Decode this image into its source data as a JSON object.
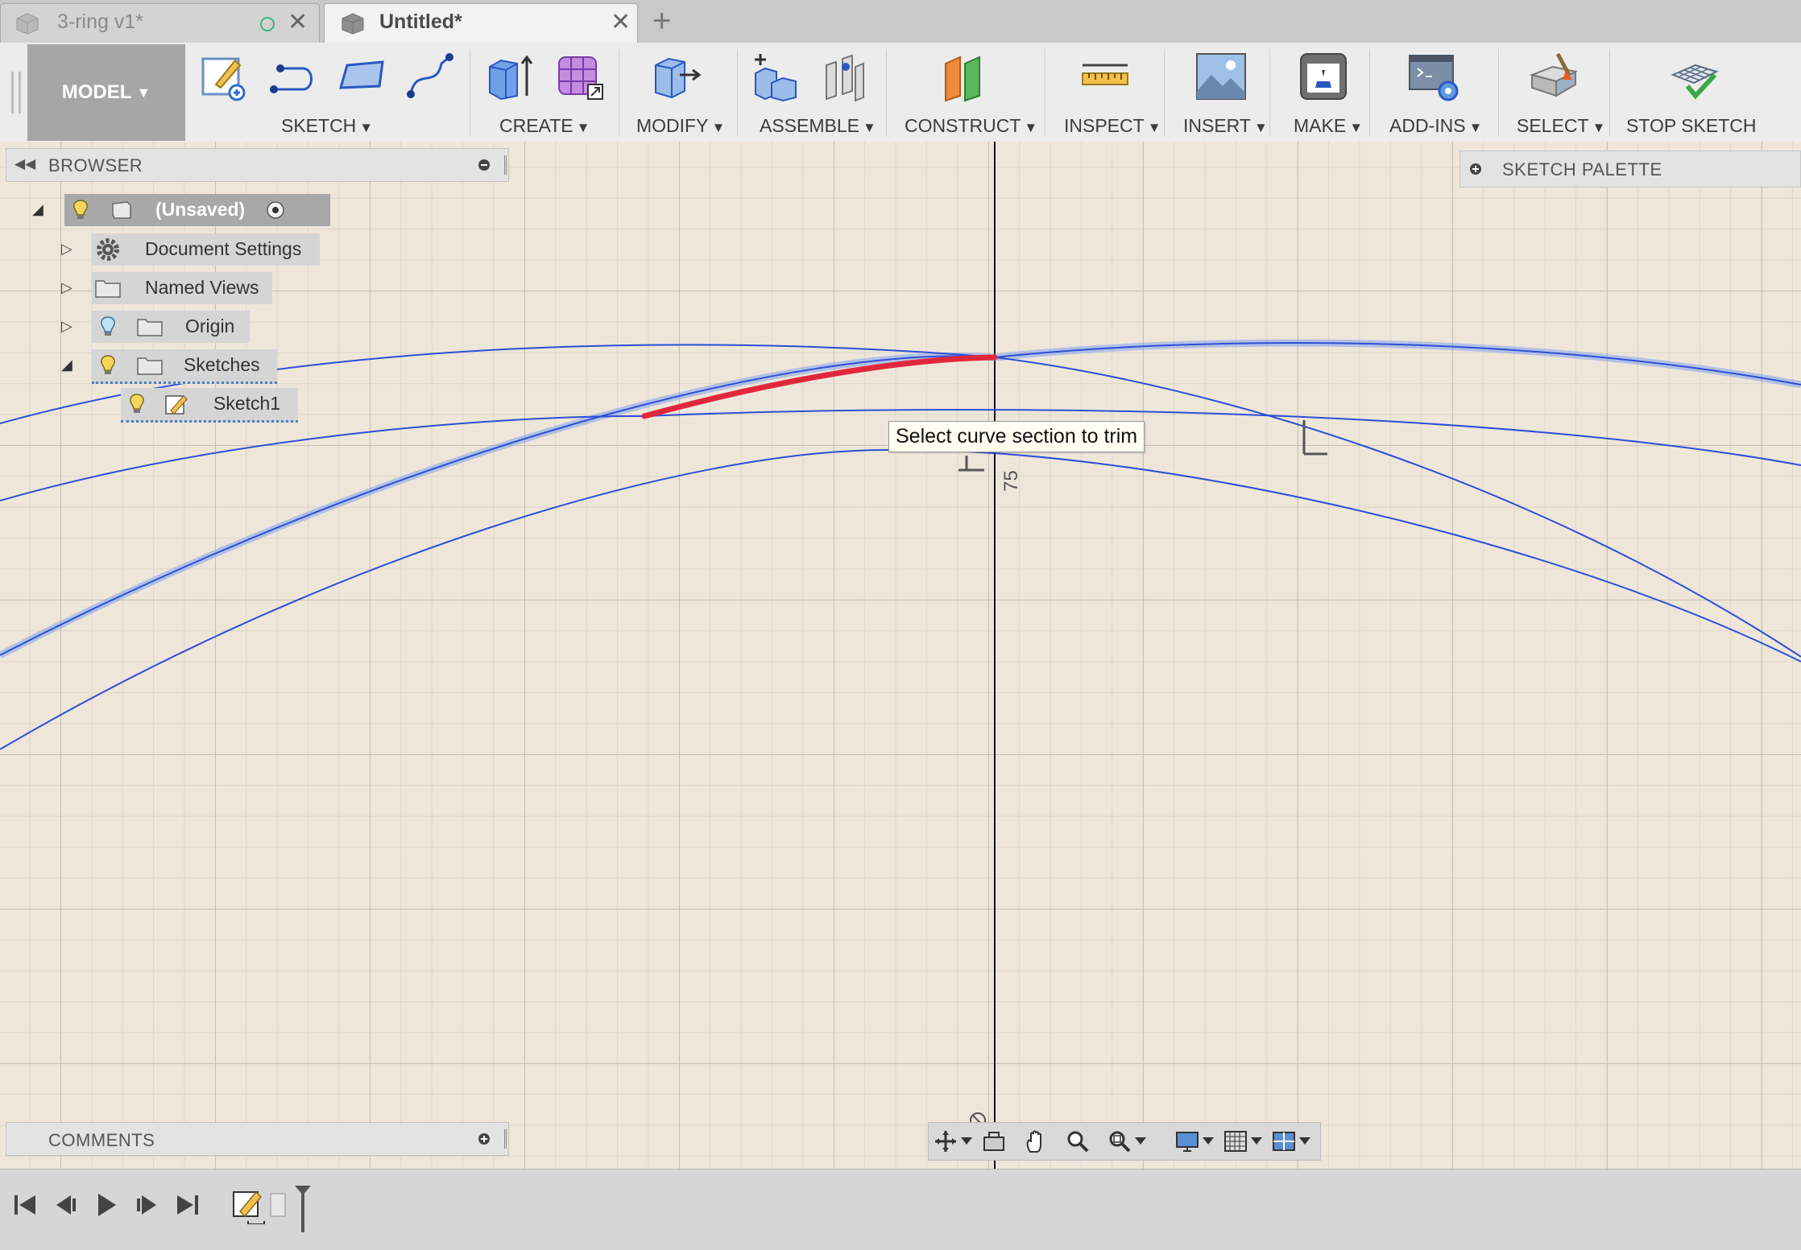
{
  "tabs": [
    {
      "title": "3-ring v1*",
      "active": false
    },
    {
      "title": "Untitled*",
      "active": true
    }
  ],
  "toolbar": {
    "workspace_label": "MODEL",
    "groups": [
      {
        "label": "SKETCH"
      },
      {
        "label": "CREATE"
      },
      {
        "label": "MODIFY"
      },
      {
        "label": "ASSEMBLE"
      },
      {
        "label": "CONSTRUCT"
      },
      {
        "label": "INSPECT"
      },
      {
        "label": "INSERT"
      },
      {
        "label": "MAKE"
      },
      {
        "label": "ADD-INS"
      },
      {
        "label": "SELECT"
      },
      {
        "label": "STOP SKETCH"
      }
    ]
  },
  "browser": {
    "title": "BROWSER",
    "items": [
      {
        "label": "(Unsaved)"
      },
      {
        "label": "Document Settings"
      },
      {
        "label": "Named Views"
      },
      {
        "label": "Origin"
      },
      {
        "label": "Sketches"
      },
      {
        "label": "Sketch1"
      }
    ]
  },
  "palette": {
    "title": "SKETCH PALETTE"
  },
  "canvas": {
    "tooltip": "Select curve section to trim",
    "dimension_label": "75"
  },
  "comments": {
    "title": "COMMENTS"
  },
  "colors": {
    "curve": "#2d4fd6",
    "trim_highlight": "#e0283c",
    "canvas_bg": "#efe6da",
    "toolbar_bg": "#ececec"
  },
  "icons": {
    "sketch": [
      "create-sketch-icon",
      "line-icon",
      "rectangle-icon",
      "spline-icon"
    ],
    "create": [
      "extrude-icon",
      "form-icon"
    ],
    "modify": [
      "press-pull-icon"
    ],
    "assemble": [
      "new-component-icon",
      "joint-icon"
    ],
    "construct": [
      "offset-plane-icon"
    ],
    "inspect": [
      "measure-icon"
    ],
    "insert": [
      "canvas-image-icon"
    ],
    "make": [
      "3d-print-icon"
    ],
    "addins": [
      "scripts-icon"
    ],
    "select": [
      "select-icon"
    ],
    "stop_sketch": [
      "stop-sketch-icon"
    ]
  }
}
